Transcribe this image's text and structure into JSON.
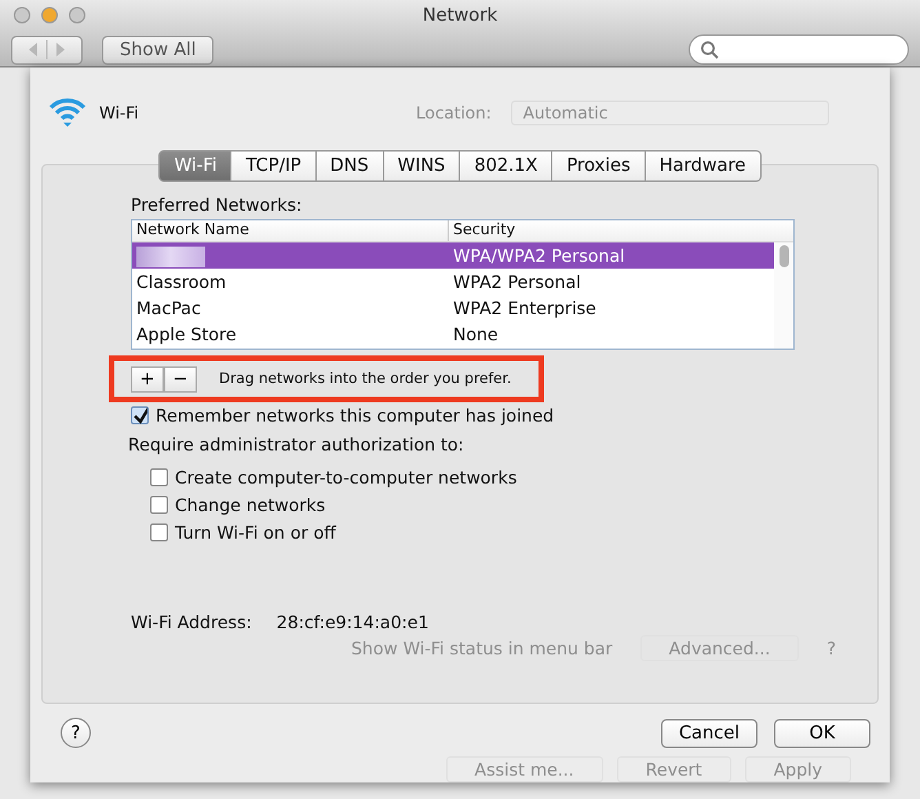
{
  "window": {
    "title": "Network",
    "traffic_lights": [
      {
        "color": "#c9c9c9"
      },
      {
        "color": "#f0a830"
      },
      {
        "color": "#c9c9c9"
      }
    ]
  },
  "toolbar": {
    "show_all": "Show All"
  },
  "background": {
    "location_label": "Location:",
    "location_value": "Automatic",
    "show_status": "Show Wi-Fi status in menu bar",
    "advanced": "Advanced...",
    "help": "?",
    "buttons": [
      "Assist me...",
      "Revert",
      "Apply"
    ]
  },
  "sheet": {
    "service": "Wi-Fi",
    "tabs": [
      {
        "label": "Wi-Fi",
        "selected": true
      },
      {
        "label": "TCP/IP",
        "selected": false
      },
      {
        "label": "DNS",
        "selected": false
      },
      {
        "label": "WINS",
        "selected": false
      },
      {
        "label": "802.1X",
        "selected": false
      },
      {
        "label": "Proxies",
        "selected": false
      },
      {
        "label": "Hardware",
        "selected": false
      }
    ],
    "preferred_label": "Preferred Networks:",
    "table": {
      "columns": [
        "Network Name",
        "Security"
      ],
      "rows": [
        {
          "name": "",
          "security": "WPA/WPA2 Personal",
          "selected": true,
          "redacted": true
        },
        {
          "name": "Classroom",
          "security": "WPA2 Personal",
          "selected": false,
          "redacted": false
        },
        {
          "name": "MacPac",
          "security": "WPA2 Enterprise",
          "selected": false,
          "redacted": false
        },
        {
          "name": "Apple Store",
          "security": "None",
          "selected": false,
          "redacted": false
        }
      ]
    },
    "add": "+",
    "remove": "−",
    "hint": "Drag networks into the order you prefer.",
    "highlighted": true,
    "remember": {
      "label": "Remember networks this computer has joined",
      "checked": true
    },
    "require_label": "Require administrator authorization to:",
    "options": [
      {
        "label": "Create computer-to-computer networks",
        "checked": false
      },
      {
        "label": "Change networks",
        "checked": false
      },
      {
        "label": "Turn Wi-Fi on or off",
        "checked": false
      }
    ],
    "address_label": "Wi-Fi Address:",
    "address": "28:cf:e9:14:a0:e1",
    "help": "?",
    "buttons": [
      {
        "label": "Cancel"
      },
      {
        "label": "OK"
      }
    ]
  }
}
